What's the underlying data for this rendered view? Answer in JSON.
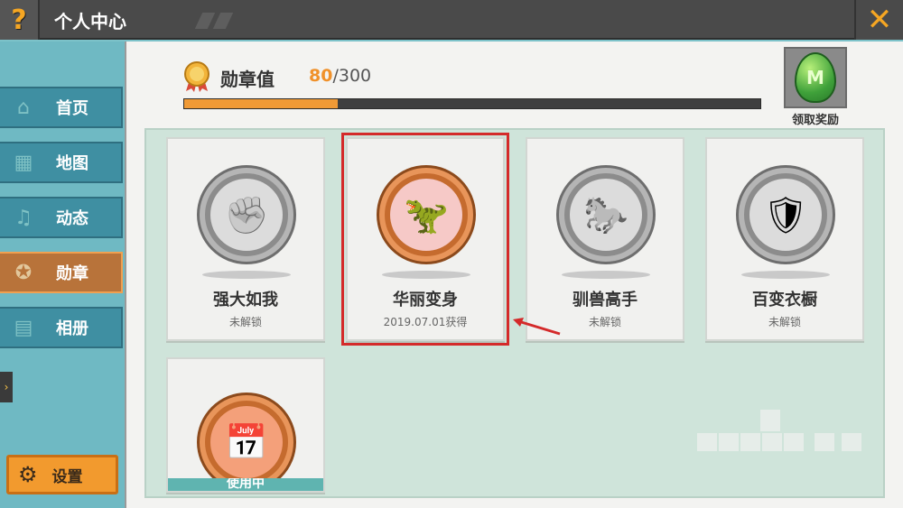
{
  "window": {
    "title": "个人中心",
    "help_glyph": "?",
    "close_glyph": "✕"
  },
  "sidebar": {
    "items": [
      {
        "label": "首页",
        "icon": "home-icon",
        "glyph": "⌂",
        "active": false
      },
      {
        "label": "地图",
        "icon": "map-icon",
        "glyph": "▦",
        "active": false
      },
      {
        "label": "动态",
        "icon": "bell-icon",
        "glyph": "♫",
        "active": false
      },
      {
        "label": "勋章",
        "icon": "medal-icon",
        "glyph": "✪",
        "active": true
      },
      {
        "label": "相册",
        "icon": "album-icon",
        "glyph": "▤",
        "active": false
      }
    ],
    "collapse_glyph": "›",
    "settings_label": "设置",
    "settings_glyph": "⚙"
  },
  "medal_bar": {
    "label": "勋章值",
    "current": "80",
    "max": "/300",
    "progress_fraction": 0.267
  },
  "reward": {
    "label": "领取奖励",
    "egg_letter": "M"
  },
  "badges": [
    {
      "name": "强大如我",
      "status": "未解锁",
      "locked": true,
      "glyph": "✊"
    },
    {
      "name": "华丽变身",
      "status": "2019.07.01获得",
      "locked": false,
      "glyph": "🦖",
      "highlighted": true
    },
    {
      "name": "驯兽高手",
      "status": "未解锁",
      "locked": true,
      "glyph": "🐎"
    },
    {
      "name": "百变衣橱",
      "status": "未解锁",
      "locked": true,
      "glyph": "🛡"
    },
    {
      "name": "",
      "status": "",
      "locked": false,
      "glyph": "📅",
      "in_use": "使用中"
    }
  ],
  "colors": {
    "accent": "#f09a36",
    "highlight": "#d42a2a",
    "nav_bg": "#3f8fa2",
    "nav_active": "#b8733a"
  }
}
